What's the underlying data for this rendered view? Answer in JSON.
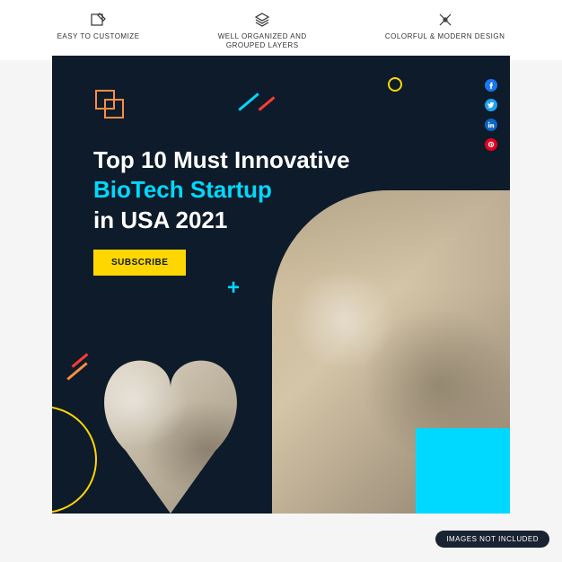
{
  "features": [
    {
      "label": "EASY TO CUSTOMIZE"
    },
    {
      "label": "WELL ORGANIZED AND\nGROUPED LAYERS"
    },
    {
      "label": "COLORFUL & MODERN DESIGN"
    }
  ],
  "headline": {
    "line1": "Top 10 Must Innovative",
    "line2": "BioTech Startup",
    "line3": "in USA 2021"
  },
  "cta": {
    "label": "SUBSCRIBE"
  },
  "social": {
    "items": [
      "facebook",
      "twitter",
      "linkedin",
      "pinterest"
    ]
  },
  "badge": {
    "label": "IMAGES NOT INCLUDED"
  },
  "colors": {
    "bg": "#0d1b2a",
    "accent_cyan": "#00d9ff",
    "accent_yellow": "#ffd700",
    "accent_orange": "#ff8c42",
    "accent_red": "#ff3b30"
  }
}
